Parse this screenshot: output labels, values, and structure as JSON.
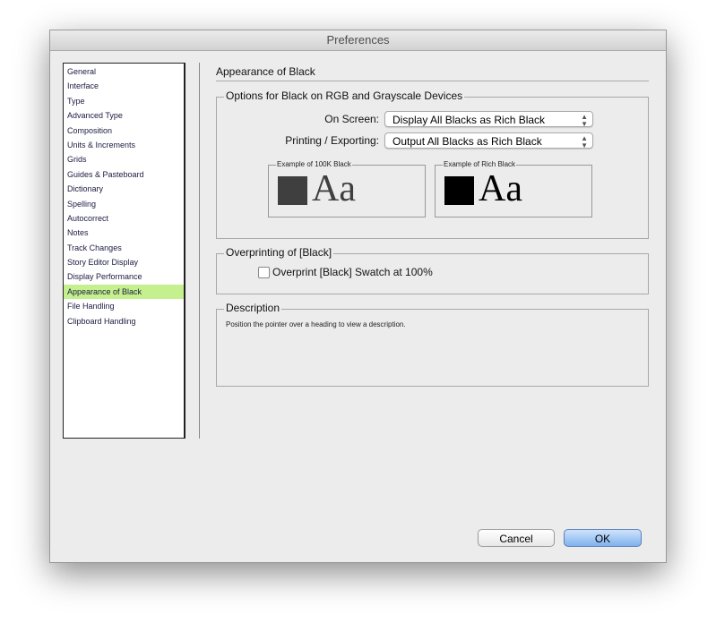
{
  "window": {
    "title": "Preferences"
  },
  "sidebar": {
    "items": [
      "General",
      "Interface",
      "Type",
      "Advanced Type",
      "Composition",
      "Units & Increments",
      "Grids",
      "Guides & Pasteboard",
      "Dictionary",
      "Spelling",
      "Autocorrect",
      "Notes",
      "Track Changes",
      "Story Editor Display",
      "Display Performance",
      "Appearance of Black",
      "File Handling",
      "Clipboard Handling"
    ],
    "selected": "Appearance of Black",
    "selected_color": "#c5f08e"
  },
  "main": {
    "title": "Appearance of Black",
    "options": {
      "title": "Options for Black on RGB and Grayscale Devices",
      "on_screen_label": "On Screen:",
      "on_screen_value": "Display All Blacks as Rich Black",
      "printing_label": "Printing / Exporting:",
      "printing_value": "Output All Blacks as Rich Black",
      "example_100k": "Example of 100K Black",
      "example_rich": "Example of Rich Black",
      "sample_text": "Aa",
      "color_100k": "#3f3f3f",
      "color_rich": "#000000"
    },
    "overprint": {
      "title": "Overprinting of [Black]",
      "checkbox_label": "Overprint [Black] Swatch at 100%",
      "checked": false
    },
    "description": {
      "title": "Description",
      "text": "Position the pointer over a heading to view a description."
    }
  },
  "buttons": {
    "cancel": "Cancel",
    "ok": "OK"
  }
}
